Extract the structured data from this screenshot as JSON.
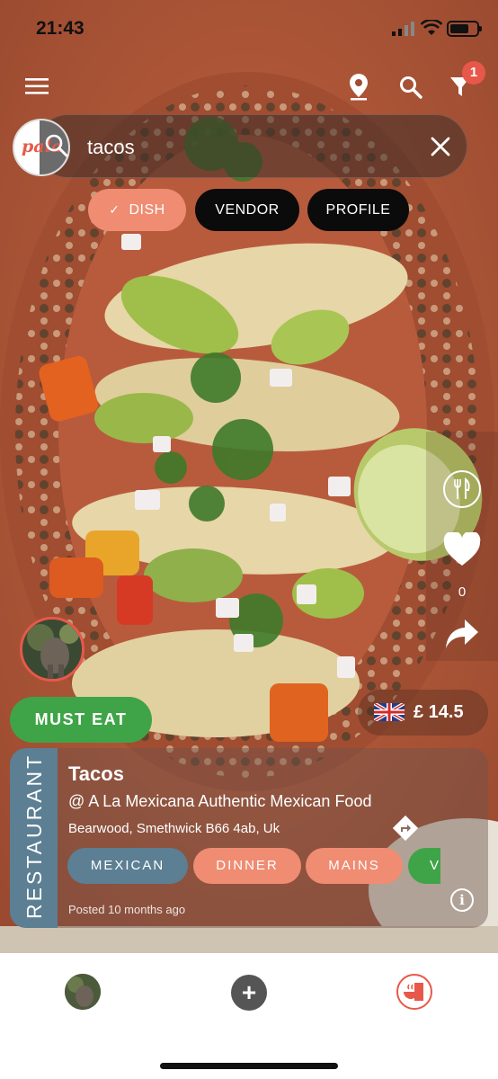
{
  "status_bar": {
    "time": "21:43"
  },
  "top_nav": {
    "filter_badge": "1"
  },
  "search": {
    "query": "tacos"
  },
  "filter_chips": [
    {
      "label": "DISH",
      "selected": true
    },
    {
      "label": "VENDOR",
      "selected": false
    },
    {
      "label": "PROFILE",
      "selected": false
    }
  ],
  "post": {
    "likes": "0",
    "must_eat_label": "MUST EAT",
    "price": "£ 14.5",
    "category": "RESTAURANT",
    "dish_name": "Tacos",
    "vendor": "@ A La Mexicana Authentic Mexican Food",
    "address": "Bearwood, Smethwick B66 4ab, Uk",
    "tags": [
      "MEXICAN",
      "DINNER",
      "MAINS",
      "V"
    ],
    "posted": "Posted 10 months ago"
  },
  "colors": {
    "accent": "#ef8c72",
    "green": "#3fa447",
    "slate": "#5c7f93",
    "badge": "#e8584a"
  },
  "icons": [
    "menu-icon",
    "location-pin-icon",
    "search-icon",
    "filter-icon",
    "close-icon",
    "utensils-icon",
    "heart-icon",
    "share-icon",
    "directions-icon",
    "info-icon",
    "add-icon"
  ]
}
